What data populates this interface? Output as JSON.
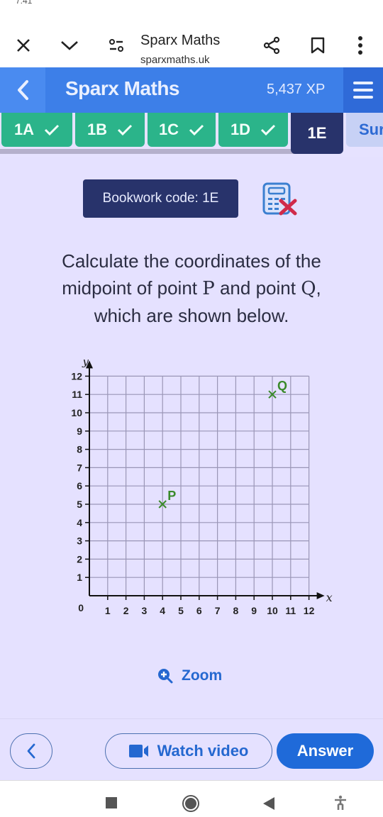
{
  "status_bar": {
    "time": "7:41"
  },
  "browser": {
    "title": "Sparx Maths",
    "url": "sparxmaths.uk",
    "icons": [
      "close-icon",
      "chevron-down-icon",
      "site-settings-icon",
      "share-icon",
      "bookmark-icon",
      "more-vert-icon"
    ]
  },
  "app_bar": {
    "title": "Sparx Maths",
    "xp": "5,437 XP",
    "back_icon": "chevron-left-icon",
    "menu_icon": "hamburger-menu-icon"
  },
  "tabs": [
    {
      "label": "1A",
      "completed": true
    },
    {
      "label": "1B",
      "completed": true
    },
    {
      "label": "1C",
      "completed": true
    },
    {
      "label": "1D",
      "completed": true
    },
    {
      "label": "1E",
      "completed": false,
      "active": true
    },
    {
      "label": "Sur",
      "completed": false
    }
  ],
  "bookwork": {
    "label": "Bookwork code: 1E",
    "calculator_icon": "calculator-not-allowed-icon"
  },
  "question": {
    "line1": "Calculate the coordinates of the",
    "line2_pre": "midpoint of point ",
    "point_a": "P",
    "line2_mid": " and point ",
    "point_b": "Q",
    "line2_post": ",",
    "line3": "which are shown below."
  },
  "chart_data": {
    "type": "scatter",
    "title": "",
    "xlabel": "x",
    "ylabel": "y",
    "xlim": [
      0,
      12
    ],
    "ylim": [
      0,
      12
    ],
    "grid": true,
    "x_ticks": [
      "1",
      "2",
      "3",
      "4",
      "5",
      "6",
      "7",
      "8",
      "9",
      "10",
      "11",
      "12"
    ],
    "y_ticks": [
      "1",
      "2",
      "3",
      "4",
      "5",
      "6",
      "7",
      "8",
      "9",
      "10",
      "11",
      "12"
    ],
    "origin_label": "0",
    "points": [
      {
        "label": "P",
        "x": 4,
        "y": 5
      },
      {
        "label": "Q",
        "x": 10,
        "y": 11
      }
    ],
    "point_color": "#3a8a2a"
  },
  "zoom": {
    "label": "Zoom"
  },
  "footer": {
    "back_label": "",
    "watch_video_label": "Watch video",
    "answer_label": "Answer"
  },
  "colors": {
    "primary": "#3d7fe8",
    "tab_completed": "#2bb48a",
    "tab_active": "#28336b",
    "background": "#e5e1ff",
    "accent_button": "#1f6ad9"
  }
}
